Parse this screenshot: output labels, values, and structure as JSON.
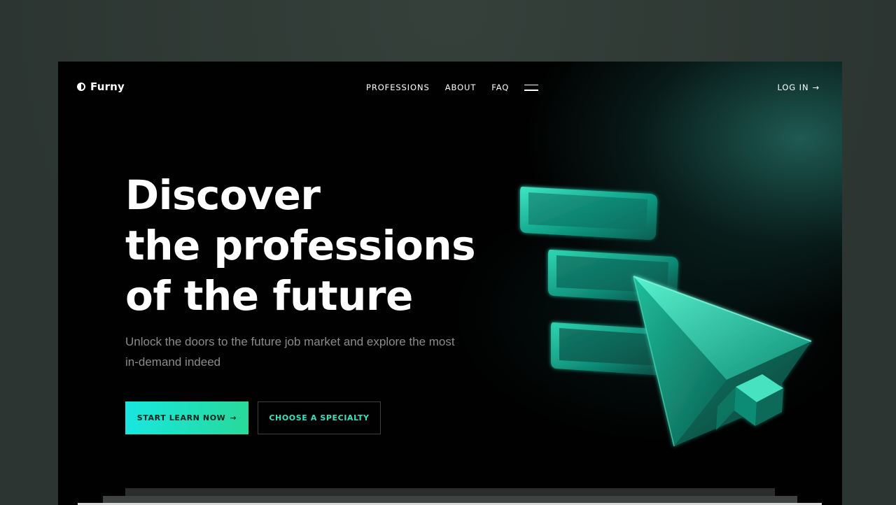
{
  "brand": {
    "name": "Furny",
    "logo_icon": "half-circle-icon"
  },
  "nav": {
    "items": [
      {
        "label": "PROFESSIONS"
      },
      {
        "label": "ABOUT"
      },
      {
        "label": "FAQ"
      }
    ],
    "menu_icon": "hamburger-menu-icon",
    "login_label": "LOG IN",
    "login_icon": "arrow-right-icon"
  },
  "hero": {
    "headline_lines": [
      "Discover",
      "the professions",
      "of the future"
    ],
    "subtitle": "Unlock the doors to the future job market and explore the most in-demand indeed",
    "primary_cta": "START LEARN NOW",
    "primary_cta_icon": "arrow-right-icon",
    "secondary_cta": "CHOOSE A SPECIALTY"
  },
  "colors": {
    "page_background": "#2c3531",
    "frame_background": "#010101",
    "accent_start": "#18e7e0",
    "accent_end": "#28d99a",
    "secondary_text": "#2ee5c0",
    "muted_text": "#8a8d8c"
  }
}
